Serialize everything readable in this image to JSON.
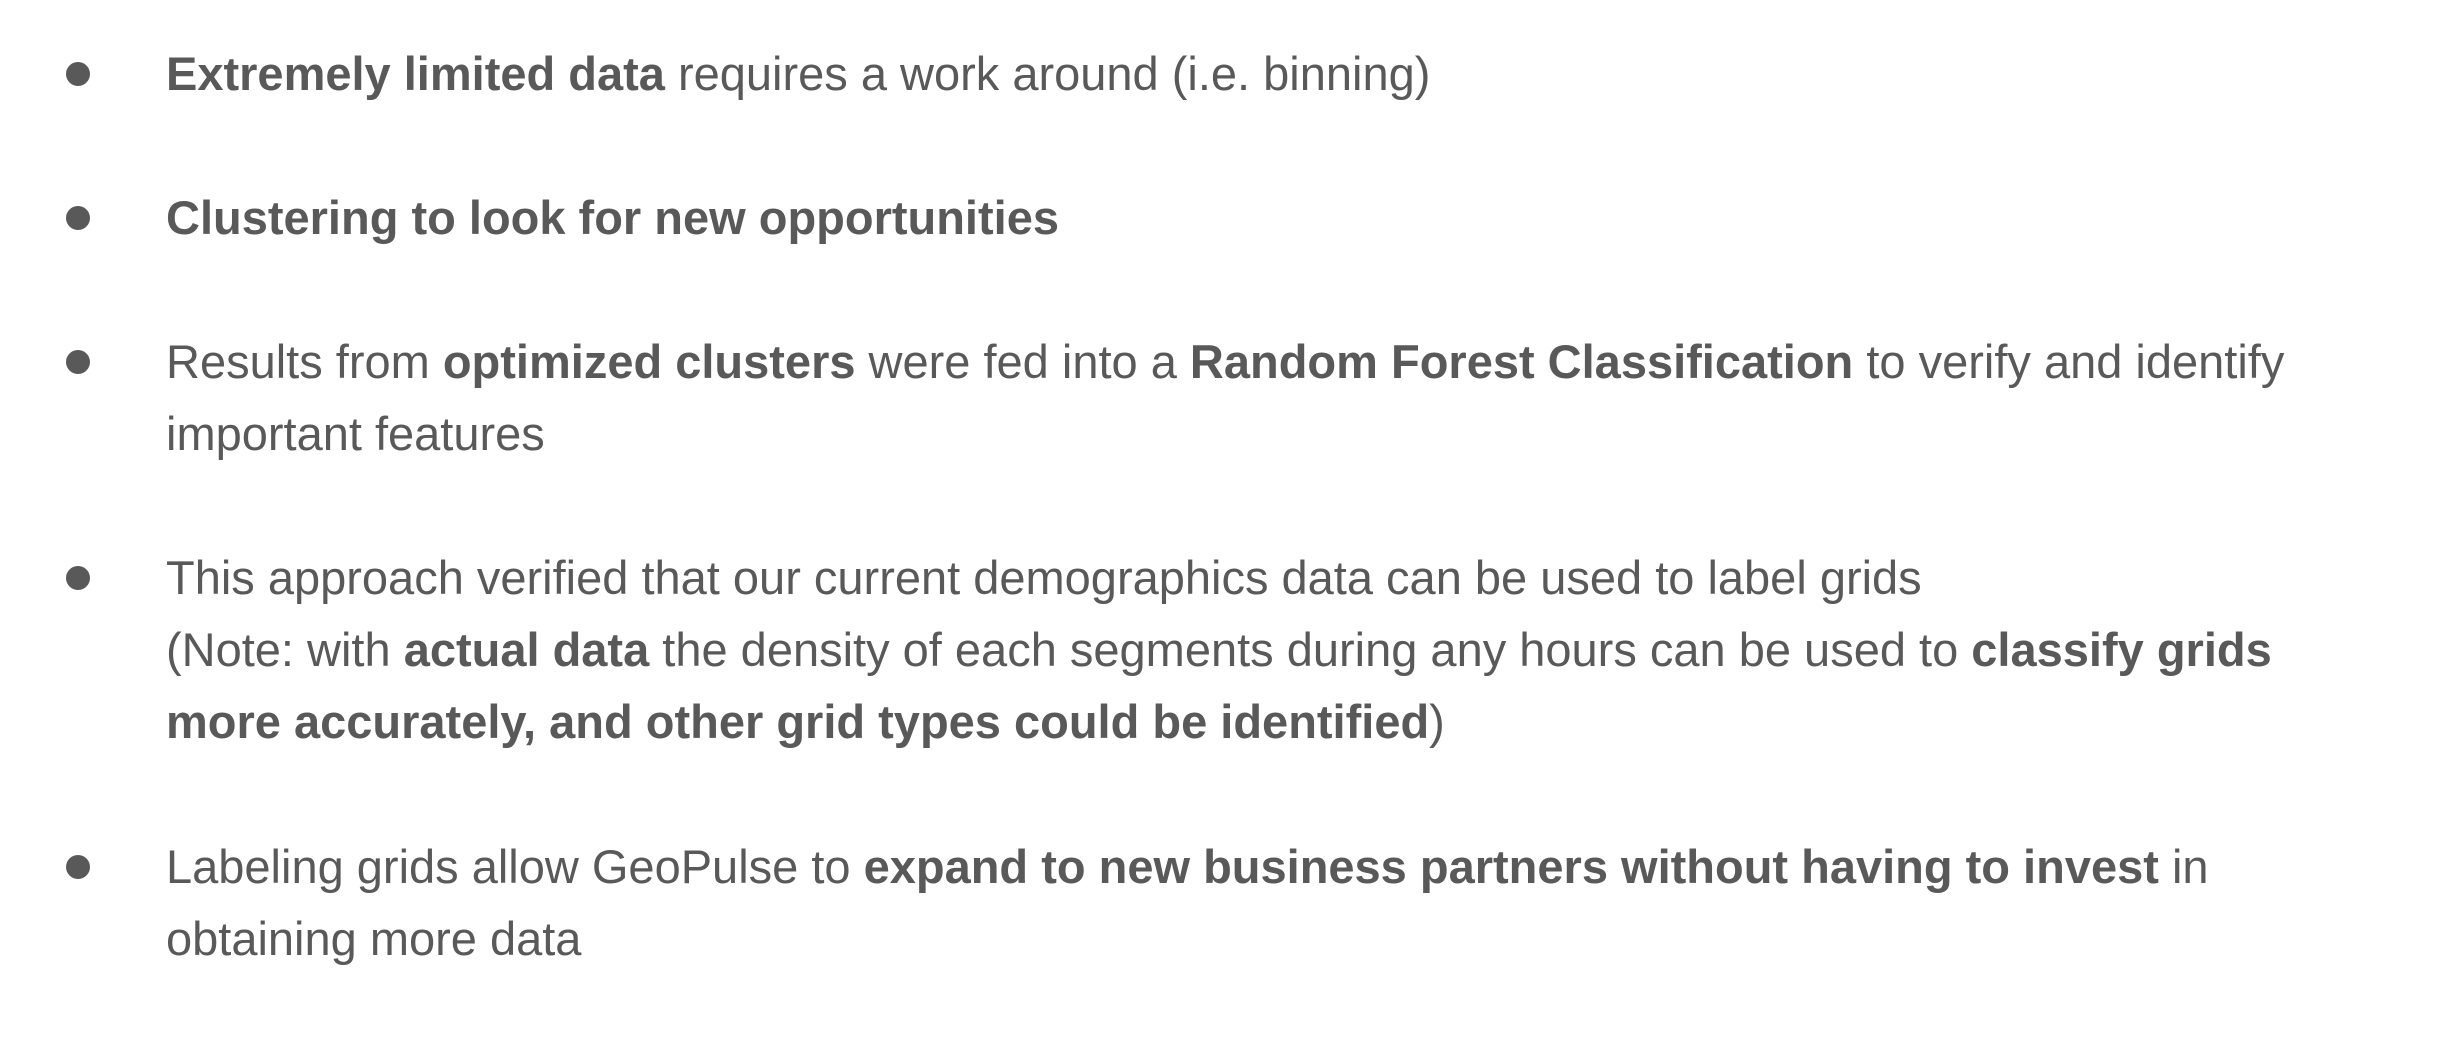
{
  "bullets": [
    {
      "lines": [
        [
          {
            "text": "Extremely limited data",
            "bold": true
          },
          {
            "text": " requires a work around (i.e. binning)",
            "bold": false
          }
        ]
      ]
    },
    {
      "lines": [
        [
          {
            "text": "Clustering to look for new opportunities",
            "bold": true
          }
        ]
      ]
    },
    {
      "lines": [
        [
          {
            "text": "Results from ",
            "bold": false
          },
          {
            "text": "optimized clusters",
            "bold": true
          },
          {
            "text": " were fed into a ",
            "bold": false
          },
          {
            "text": "Random Forest Classification",
            "bold": true
          },
          {
            "text": " to verify and identify",
            "bold": false
          }
        ],
        [
          {
            "text": "important features",
            "bold": false
          }
        ]
      ]
    },
    {
      "lines": [
        [
          {
            "text": "This approach verified that our current demographics data can be used to label grids",
            "bold": false
          }
        ],
        [
          {
            "text": "(Note: with ",
            "bold": false
          },
          {
            "text": "actual data",
            "bold": true
          },
          {
            "text": " the density of each segments during any hours can be used to ",
            "bold": false
          },
          {
            "text": "classify grids",
            "bold": true
          }
        ],
        [
          {
            "text": "more accurately, and other grid types could be identified",
            "bold": true
          },
          {
            "text": ")",
            "bold": false
          }
        ]
      ]
    },
    {
      "lines": [
        [
          {
            "text": "Labeling grids allow GeoPulse to ",
            "bold": false
          },
          {
            "text": "expand to new business partners without having to invest",
            "bold": true
          },
          {
            "text": " in",
            "bold": false
          }
        ],
        [
          {
            "text": "obtaining more data",
            "bold": false
          }
        ]
      ]
    }
  ]
}
